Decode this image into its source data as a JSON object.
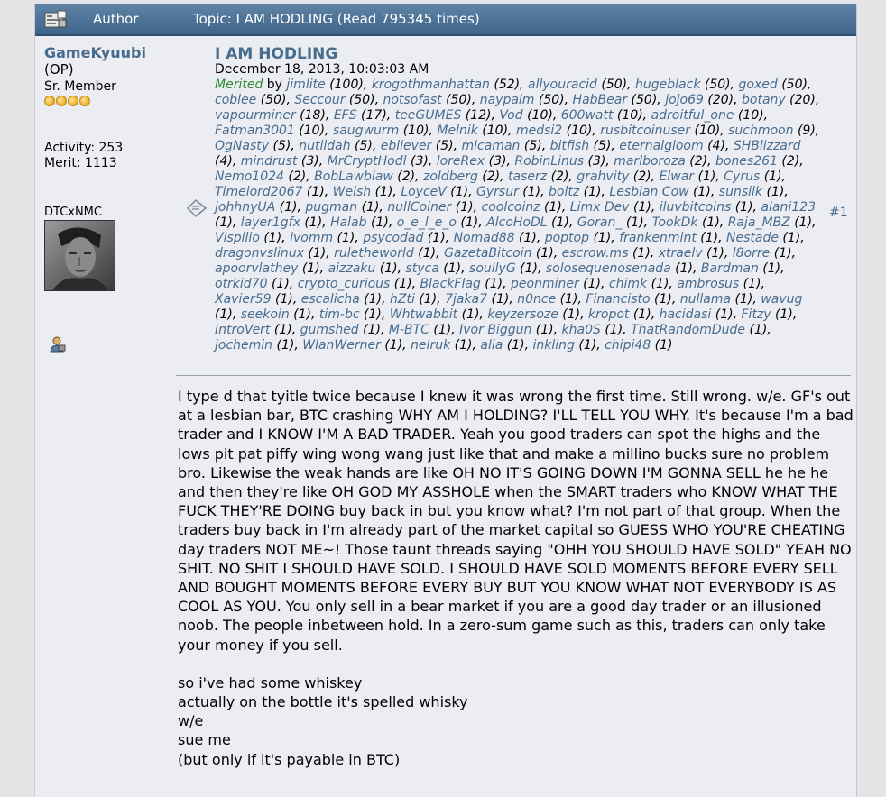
{
  "header": {
    "author_label": "Author",
    "topic_text": "Topic: I AM HODLING  (Read 795345 times)"
  },
  "poster": {
    "name": "GameKyuubi",
    "op": "(OP)",
    "rank": "Sr. Member",
    "stars": 4,
    "activity": "Activity: 253",
    "merit": "Merit: 1113",
    "sig_name": "DTCxNMC"
  },
  "post": {
    "subject": "I AM HODLING",
    "date": "December 18, 2013, 10:03:03 AM",
    "number": "#1",
    "merited_label": "Merited",
    "merited_by": "by",
    "meriters": [
      [
        "jimlite",
        "100"
      ],
      [
        "krogothmanhattan",
        "52"
      ],
      [
        "allyouracid",
        "50"
      ],
      [
        "hugeblack",
        "50"
      ],
      [
        "goxed",
        "50"
      ],
      [
        "coblee",
        "50"
      ],
      [
        "Seccour",
        "50"
      ],
      [
        "notsofast",
        "50"
      ],
      [
        "naypalm",
        "50"
      ],
      [
        "HabBear",
        "50"
      ],
      [
        "jojo69",
        "20"
      ],
      [
        "botany",
        "20"
      ],
      [
        "vapourminer",
        "18"
      ],
      [
        "EFS",
        "17"
      ],
      [
        "teeGUMES",
        "12"
      ],
      [
        "Vod",
        "10"
      ],
      [
        "600watt",
        "10"
      ],
      [
        "adroitful_one",
        "10"
      ],
      [
        "Fatman3001",
        "10"
      ],
      [
        "saugwurm",
        "10"
      ],
      [
        "Melnik",
        "10"
      ],
      [
        "medsi2",
        "10"
      ],
      [
        "rusbitcoinuser",
        "10"
      ],
      [
        "suchmoon",
        "9"
      ],
      [
        "OgNasty",
        "5"
      ],
      [
        "nutildah",
        "5"
      ],
      [
        "ebliever",
        "5"
      ],
      [
        "micaman",
        "5"
      ],
      [
        "bitfish",
        "5"
      ],
      [
        "eternalgloom",
        "4"
      ],
      [
        "SHBlizzard",
        "4"
      ],
      [
        "mindrust",
        "3"
      ],
      [
        "MrCryptHodl",
        "3"
      ],
      [
        "loreRex",
        "3"
      ],
      [
        "RobinLinus",
        "3"
      ],
      [
        "marlboroza",
        "2"
      ],
      [
        "bones261",
        "2"
      ],
      [
        "Nemo1024",
        "2"
      ],
      [
        "BobLawblaw",
        "2"
      ],
      [
        "zoldberg",
        "2"
      ],
      [
        "taserz",
        "2"
      ],
      [
        "grahvity",
        "2"
      ],
      [
        "Elwar",
        "1"
      ],
      [
        "Cyrus",
        "1"
      ],
      [
        "Timelord2067",
        "1"
      ],
      [
        "Welsh",
        "1"
      ],
      [
        "LoyceV",
        "1"
      ],
      [
        "Gyrsur",
        "1"
      ],
      [
        "boltz",
        "1"
      ],
      [
        "Lesbian Cow",
        "1"
      ],
      [
        "sunsilk",
        "1"
      ],
      [
        "johhnyUA",
        "1"
      ],
      [
        "pugman",
        "1"
      ],
      [
        "nullCoiner",
        "1"
      ],
      [
        "coolcoinz",
        "1"
      ],
      [
        "Limx Dev",
        "1"
      ],
      [
        "iluvbitcoins",
        "1"
      ],
      [
        "alani123",
        "1"
      ],
      [
        "layer1gfx",
        "1"
      ],
      [
        "Halab",
        "1"
      ],
      [
        "o_e_l_e_o",
        "1"
      ],
      [
        "AlcoHoDL",
        "1"
      ],
      [
        "Goran_",
        "1"
      ],
      [
        "TookDk",
        "1"
      ],
      [
        "Raja_MBZ",
        "1"
      ],
      [
        "Vispilio",
        "1"
      ],
      [
        "ivomm",
        "1"
      ],
      [
        "psycodad",
        "1"
      ],
      [
        "Nomad88",
        "1"
      ],
      [
        "poptop",
        "1"
      ],
      [
        "frankenmint",
        "1"
      ],
      [
        "Nestade",
        "1"
      ],
      [
        "dragonvslinux",
        "1"
      ],
      [
        "ruletheworld",
        "1"
      ],
      [
        "GazetaBitcoin",
        "1"
      ],
      [
        "escrow.ms",
        "1"
      ],
      [
        "xtraelv",
        "1"
      ],
      [
        "l8orre",
        "1"
      ],
      [
        "apoorvlathey",
        "1"
      ],
      [
        "aizzaku",
        "1"
      ],
      [
        "styca",
        "1"
      ],
      [
        "soullyG",
        "1"
      ],
      [
        "solosequenosenada",
        "1"
      ],
      [
        "Bardman",
        "1"
      ],
      [
        "otrkid70",
        "1"
      ],
      [
        "crypto_curious",
        "1"
      ],
      [
        "BlackFlag",
        "1"
      ],
      [
        "peonminer",
        "1"
      ],
      [
        "chimk",
        "1"
      ],
      [
        "ambrosus",
        "1"
      ],
      [
        "Xavier59",
        "1"
      ],
      [
        "escalicha",
        "1"
      ],
      [
        "hZti",
        "1"
      ],
      [
        "7jaka7",
        "1"
      ],
      [
        "n0nce",
        "1"
      ],
      [
        "Financisto",
        "1"
      ],
      [
        "nullama",
        "1"
      ],
      [
        "wavug",
        "1"
      ],
      [
        "seekoin",
        "1"
      ],
      [
        "tim-bc",
        "1"
      ],
      [
        "Whtwabbit",
        "1"
      ],
      [
        "keyzersoze",
        "1"
      ],
      [
        "kropot",
        "1"
      ],
      [
        "hacidasi",
        "1"
      ],
      [
        "Fitzy",
        "1"
      ],
      [
        "IntroVert",
        "1"
      ],
      [
        "gumshed",
        "1"
      ],
      [
        "M-BTC",
        "1"
      ],
      [
        "Ivor Biggun",
        "1"
      ],
      [
        "kha0S",
        "1"
      ],
      [
        "ThatRandomDude",
        "1"
      ],
      [
        "jochemin",
        "1"
      ],
      [
        "WlanWerner",
        "1"
      ],
      [
        "nelruk",
        "1"
      ],
      [
        "alia",
        "1"
      ],
      [
        "inkling",
        "1"
      ],
      [
        "chipi48",
        "1"
      ]
    ],
    "paragraph": "I type d that tyitle twice because I knew it was wrong the first time.  Still wrong.  w/e.  GF's out at a lesbian bar, BTC crashing WHY AM I HOLDING? I'LL TELL YOU WHY.  It's because I'm a bad trader and I KNOW I'M A BAD TRADER.  Yeah you good traders can spot the highs and the lows pit pat piffy wing wong wang just like that and make a millino bucks sure no problem bro.  Likewise the weak hands are like OH NO IT'S GOING DOWN I'M GONNA SELL he he he and then they're like OH GOD MY ASSHOLE when the SMART traders who KNOW WHAT THE FUCK THEY'RE DOING buy back in but you know what?  I'm not part of that group.  When the traders buy back in I'm already part of the market capital so GUESS WHO YOU'RE CHEATING day traders NOT ME~!  Those taunt threads saying \"OHH YOU SHOULD HAVE SOLD\" YEAH NO SHIT.  NO SHIT I SHOULD HAVE SOLD.  I SHOULD HAVE SOLD MOMENTS BEFORE EVERY SELL AND BOUGHT MOMENTS BEFORE EVERY BUY BUT YOU KNOW WHAT NOT EVERYBODY IS AS COOL AS YOU.  You only sell in a bear market if you are a good day trader or an illusioned noob.  The people inbetween hold.  In a zero-sum game such as this, traders can only take your money if you sell.",
    "lines": [
      "so i've had some whiskey",
      "actually on the bottle it's spelled whisky",
      "w/e",
      "sue me",
      "(but only if it's payable in BTC)"
    ]
  }
}
